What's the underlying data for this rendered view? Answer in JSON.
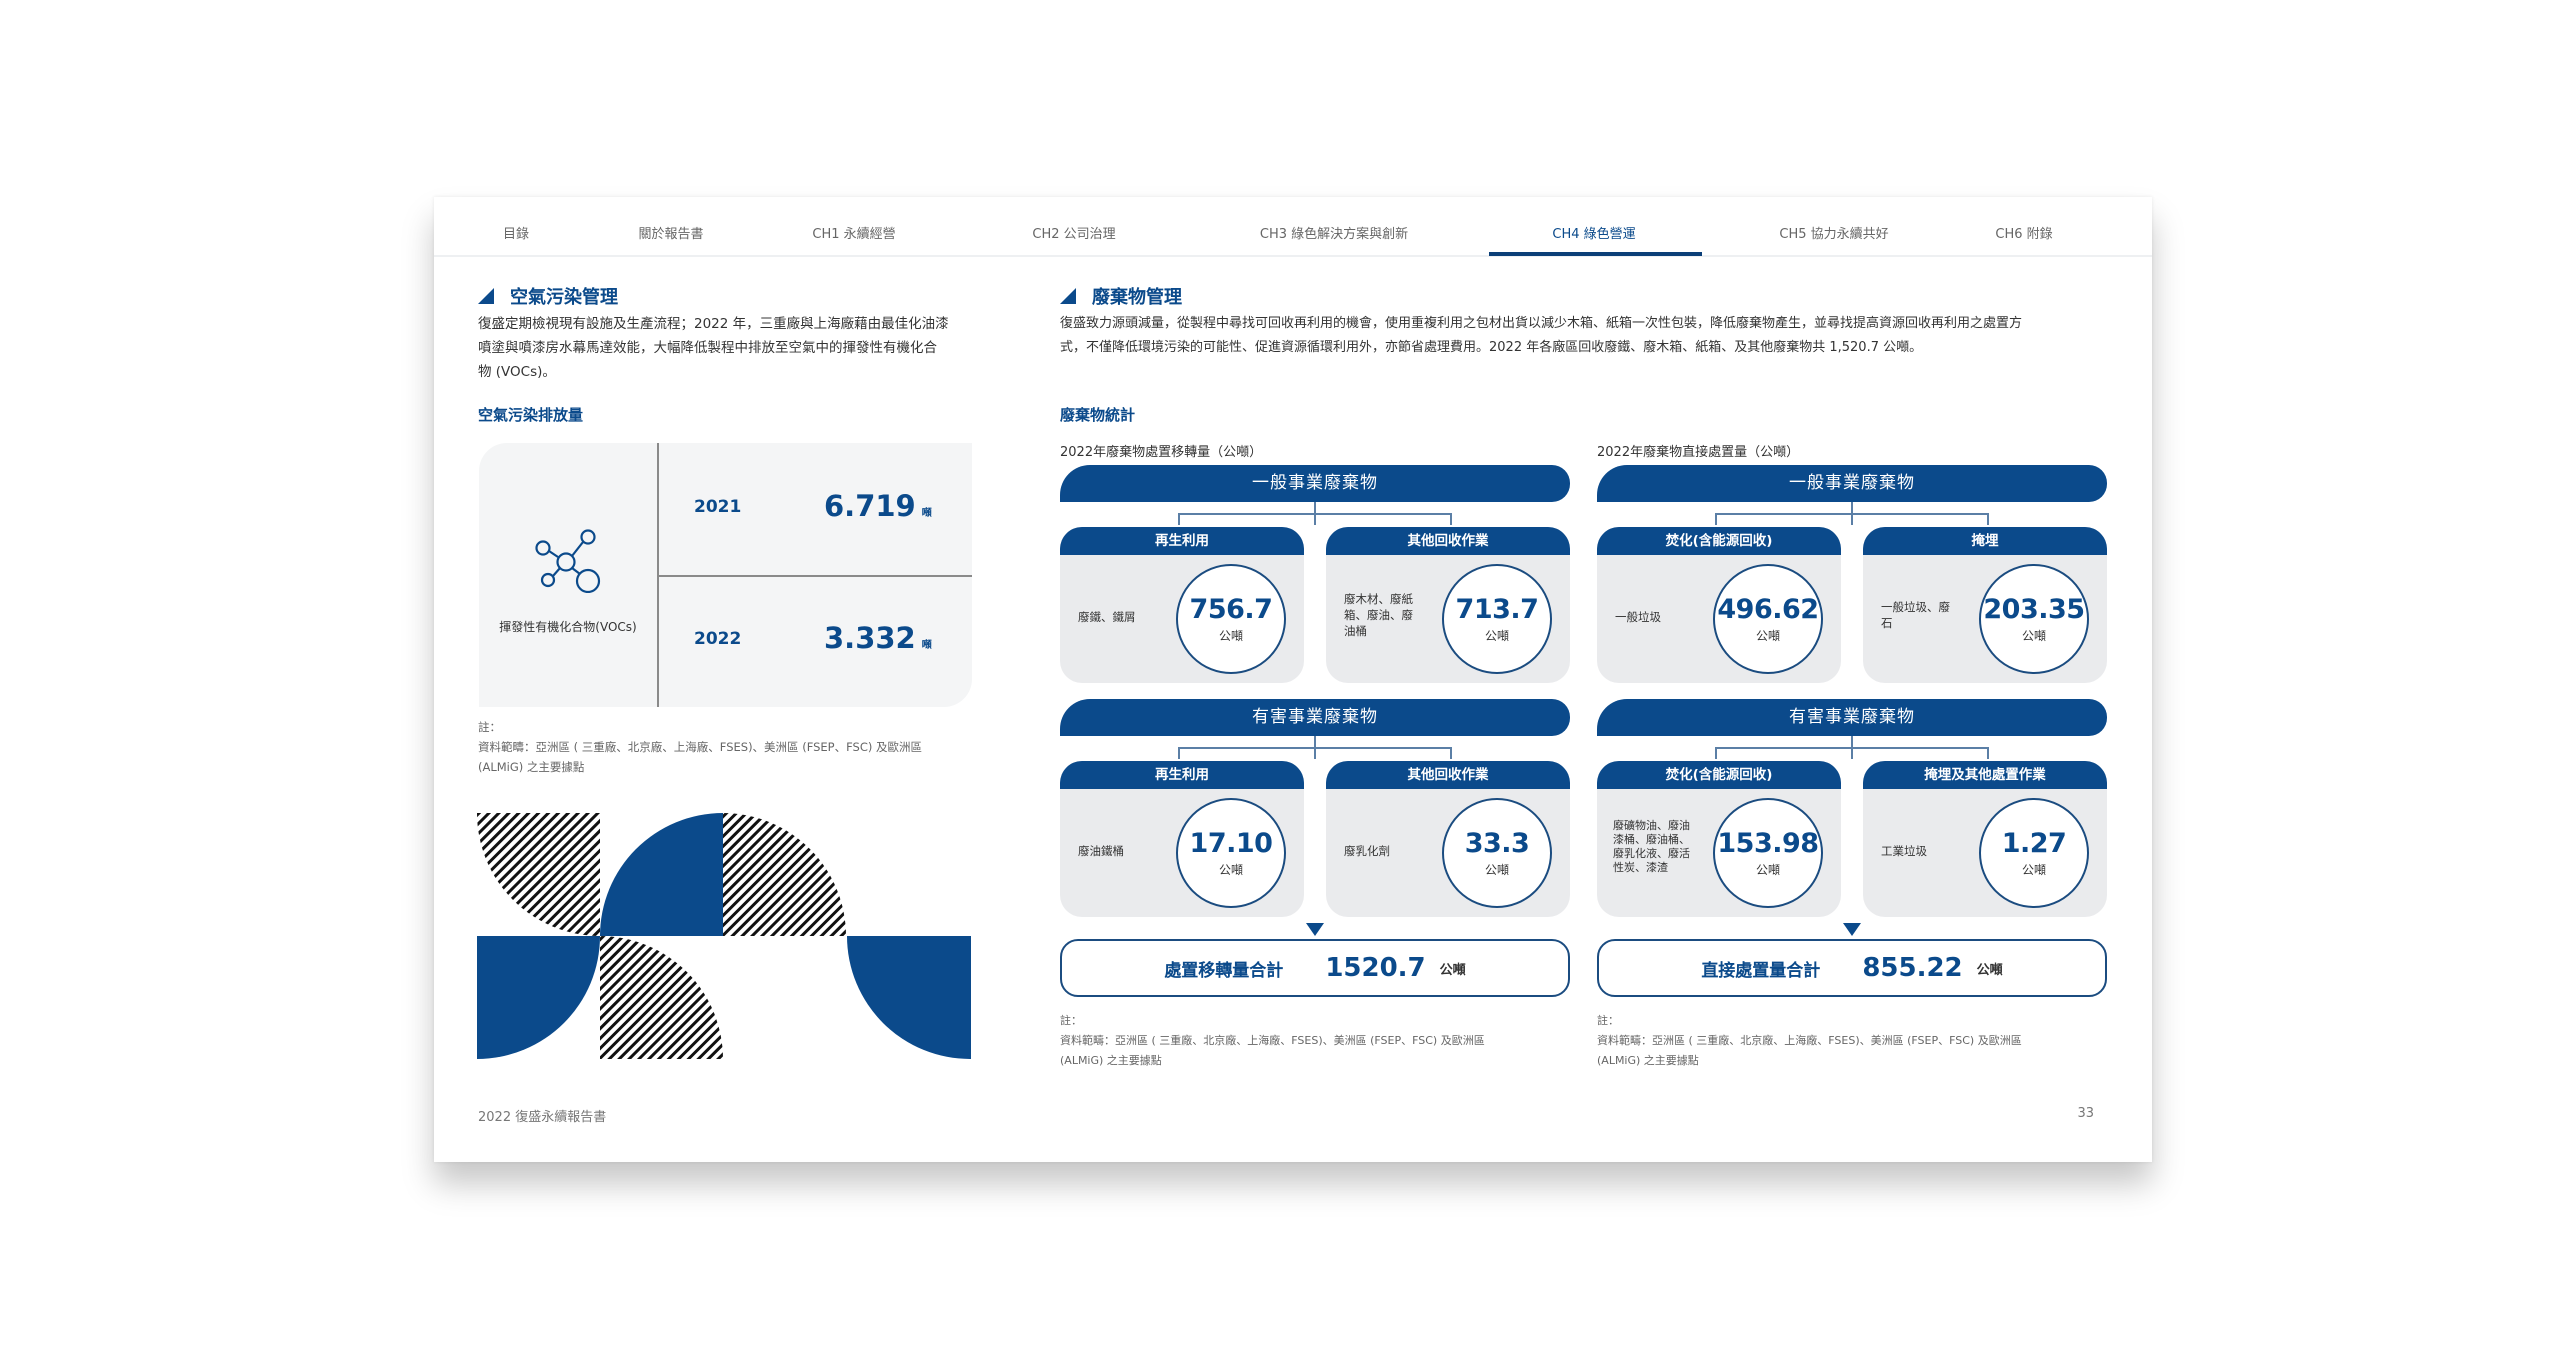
{
  "nav": {
    "tabs": [
      {
        "label": "目錄",
        "active": false
      },
      {
        "label": "關於報告書",
        "active": false
      },
      {
        "label": "CH1 永續經營",
        "active": false
      },
      {
        "label": "CH2 公司治理",
        "active": false
      },
      {
        "label": "CH3 綠色解決方案與創新",
        "active": false
      },
      {
        "label": "CH4 綠色營運",
        "active": true
      },
      {
        "label": "CH5 協力永續共好",
        "active": false
      },
      {
        "label": "CH6 附錄",
        "active": false
      }
    ]
  },
  "left": {
    "section_title": "空氣污染管理",
    "paragraph_lines": [
      "復盛定期檢視現有設施及生產流程；2022 年，三重廠與上海廠藉由最佳化油漆",
      "噴塗與噴漆房水幕馬達效能，大幅降低製程中排放至空氣中的揮發性有機化合",
      "物 (VOCs)。"
    ],
    "subsection_title": "空氣污染排放量",
    "voc_card": {
      "icon": "molecule-icon",
      "label": "揮發性有機化合物(VOCs)",
      "rows": [
        {
          "year": "2021",
          "value": "6.719",
          "unit": "噸"
        },
        {
          "year": "2022",
          "value": "3.332",
          "unit": "噸"
        }
      ]
    },
    "note": {
      "label": "註：",
      "lines": [
        "資料範疇：亞洲區 ( 三重廠、北京廠、上海廠、FSES)、美洲區 (FSEP、FSC) 及歐洲區",
        "(ALMiG) 之主要據點"
      ]
    }
  },
  "right": {
    "section_title": "廢棄物管理",
    "paragraph_lines": [
      "復盛致力源頭減量，從製程中尋找可回收再利用的機會，使用重複利用之包材出貨以減少木箱、紙箱一次性包裝，降低廢棄物產生，並尋找提高資源回收再利用之處置方",
      "式，不僅降低環境污染的可能性、促進資源循環利用外，亦節省處理費用。2022 年各廠區回收廢鐵、廢木箱、紙箱、及其他廢棄物共 1,520.7 公噸。"
    ],
    "subsection_title": "廢棄物統計",
    "diagrams": [
      {
        "title": "2022年廢棄物處置移轉量（公噸）",
        "groups": [
          {
            "name": "一般事業廢棄物",
            "boxes": [
              {
                "head": "再生利用",
                "desc": "廢鐵、鐵屑",
                "value": "756.7",
                "unit": "公噸"
              },
              {
                "head": "其他回收作業",
                "desc": "廢木材、廢紙箱、廢油、廢油桶",
                "value": "713.7",
                "unit": "公噸"
              }
            ]
          },
          {
            "name": "有害事業廢棄物",
            "boxes": [
              {
                "head": "再生利用",
                "desc": "廢油鐵桶",
                "value": "17.10",
                "unit": "公噸"
              },
              {
                "head": "其他回收作業",
                "desc": "廢乳化劑",
                "value": "33.3",
                "unit": "公噸"
              }
            ]
          }
        ],
        "total": {
          "label": "處置移轉量合計",
          "value": "1520.7",
          "unit": "公噸"
        }
      },
      {
        "title": "2022年廢棄物直接處置量（公噸）",
        "groups": [
          {
            "name": "一般事業廢棄物",
            "boxes": [
              {
                "head": "焚化(含能源回收)",
                "desc": "一般垃圾",
                "value": "496.62",
                "unit": "公噸"
              },
              {
                "head": "掩埋",
                "desc": "一般垃圾、廢石",
                "value": "203.35",
                "unit": "公噸"
              }
            ]
          },
          {
            "name": "有害事業廢棄物",
            "boxes": [
              {
                "head": "焚化(含能源回收)",
                "desc": "廢礦物油、廢油漆桶、廢油桶、廢乳化液、廢活性炭、漆渣",
                "value": "153.98",
                "unit": "公噸"
              },
              {
                "head": "掩埋及其他處置作業",
                "desc": "工業垃圾",
                "value": "1.27",
                "unit": "公噸"
              }
            ]
          }
        ],
        "total": {
          "label": "直接處置量合計",
          "value": "855.22",
          "unit": "公噸"
        }
      }
    ],
    "note": {
      "label": "註：",
      "lines": [
        "資料範疇：亞洲區 ( 三重廠、北京廠、上海廠、FSES)、美洲區 (FSEP、FSC) 及歐洲區",
        "(ALMiG) 之主要據點"
      ]
    }
  },
  "footer": {
    "report_title": "2022 復盛永續報告書",
    "page_number": "33"
  },
  "colors": {
    "brand_blue": "#0b4a8b",
    "box_gray": "#eaebed",
    "card_gray": "#f4f5f6"
  }
}
